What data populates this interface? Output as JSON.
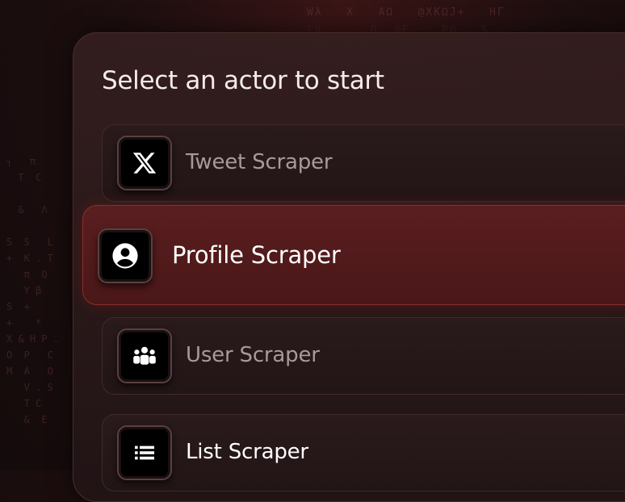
{
  "heading": "Select an actor to start",
  "actors": [
    {
      "label": "Tweet Scraper",
      "icon": "x-logo-icon",
      "selected": false
    },
    {
      "label": "Profile Scraper",
      "icon": "user-circle-icon",
      "selected": true
    },
    {
      "label": "User Scraper",
      "icon": "users-group-icon",
      "selected": false
    },
    {
      "label": "List Scraper",
      "icon": "list-icon",
      "selected": false
    }
  ],
  "background_glyphs": {
    "top": "Wλ   X   AΩ   @XKΩJ+   HГ",
    "top2": "ΓV      Q  @E    PΘ   S",
    "left": "┐   π\n  T  C\n\n  &   Λ\n\nS  S   L\n+  K . T\n   π  Q\n   Y β\nS  +\n+    *\nX & H P .\nO  P   C\nM  A   O\n   V . S\n   T C\n   &  E"
  },
  "colors": {
    "accent": "#8a2e2e",
    "active_bg": "#52191a",
    "background": "#1d0e0f"
  }
}
